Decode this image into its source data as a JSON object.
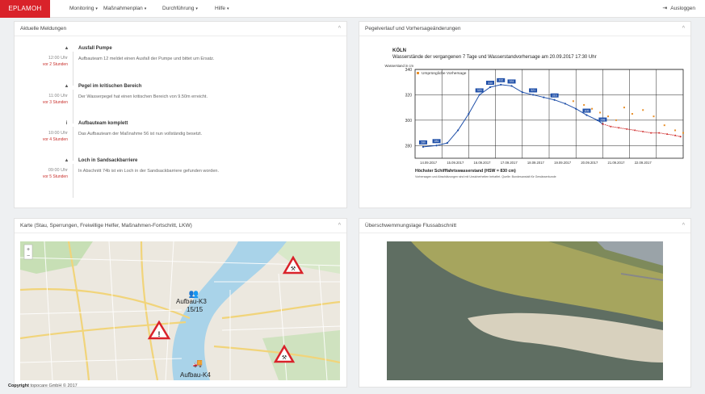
{
  "nav": {
    "brand": "EPLAMOH",
    "items": [
      {
        "label": "Monitoring"
      },
      {
        "label": "Maßnahmenplan"
      },
      {
        "label": "Durchführung"
      },
      {
        "label": "Hilfe"
      }
    ],
    "logout": "Ausloggen"
  },
  "panels": {
    "messages_title": "Aktuelle Meldungen",
    "chart_title": "Pegelverlauf und Vorhersageänderungen",
    "map_title": "Karte (Stau, Sperrungen, Freiwillige Helfer, Maßnahmen-Fortschritt, LKW)",
    "photo_title": "Überschwemmungslage Flussabschnitt"
  },
  "messages": [
    {
      "title": "Ausfall Pumpe",
      "text": "Aufbauteam 12 meldet einen Ausfall der Pumpe und bittet um Ersatz.",
      "time": "12:00 Uhr",
      "ago": "vor 2 Stunden",
      "icon": "warning-icon"
    },
    {
      "title": "Pegel im kritischen Bereich",
      "text": "Der Wasserpegel hat einen kritischen Bereich von 9.50m erreicht.",
      "time": "11:00 Uhr",
      "ago": "vor 3 Stunden",
      "icon": "warning-icon"
    },
    {
      "title": "Aufbauteam komplett",
      "text": "Das Aufbauteam der Maßnahme 56 ist nun vollständig besetzt.",
      "time": "10:00 Uhr",
      "ago": "vor 4 Stunden",
      "icon": "info-icon"
    },
    {
      "title": "Loch in Sandsackbarriere",
      "text": "In Abschnitt 74b ist ein Loch in der Sandsackbarriere gefunden worden.",
      "time": "09:00 Uhr",
      "ago": "vor 5 Stunden",
      "icon": "warning-icon"
    }
  ],
  "chart_data": {
    "type": "line",
    "title": "KÖLN",
    "subtitle": "Wasserstände der vergangenen 7 Tage und Wasserstandvorhersage am 20.09.2017 17:30 Uhr",
    "ylabel": "Wasserstand in cm",
    "legend": "Ursprüngliche Vorhersage",
    "ylim": [
      270,
      340
    ],
    "yticks": [
      280,
      300,
      320,
      340
    ],
    "xtick_labels": [
      "14.09.2017",
      "15.09.2017",
      "16.09.2017",
      "17.09.2017",
      "18.09.2017",
      "19.09.2017",
      "20.09.2017",
      "21.09.2017",
      "22.09.2017"
    ],
    "x_range": [
      0,
      10
    ],
    "series": [
      {
        "values_x": [
          0.3,
          0.8,
          1.2,
          1.6,
          2.0,
          2.4,
          2.8,
          3.2,
          3.6,
          4.0,
          4.4,
          4.8,
          5.2,
          5.6,
          6.0,
          6.4,
          6.8,
          7.0
        ],
        "values_y": [
          279,
          280,
          282,
          292,
          305,
          320,
          326,
          328,
          327,
          322,
          320,
          318,
          316,
          313,
          309,
          304,
          300,
          297
        ]
      },
      {
        "values_x": [
          7.0,
          7.3,
          7.6,
          7.9,
          8.2,
          8.5,
          8.8,
          9.1,
          9.4,
          9.7,
          9.9
        ],
        "values_y": [
          297,
          295,
          294,
          293,
          292,
          291,
          290,
          290,
          289,
          288,
          287
        ]
      },
      {
        "values_x": [
          5.9,
          6.3,
          6.6,
          6.9,
          7.2,
          7.5,
          7.8,
          8.1,
          8.5,
          8.9,
          9.3,
          9.7,
          10.0
        ],
        "values_y": [
          315,
          312,
          309,
          306,
          303,
          300,
          310,
          305,
          308,
          303,
          296,
          292,
          290
        ]
      }
    ],
    "data_labels": [
      {
        "x": 0.3,
        "y": 279,
        "text": "280"
      },
      {
        "x": 0.8,
        "y": 280,
        "text": "281"
      },
      {
        "x": 2.4,
        "y": 320,
        "text": "320"
      },
      {
        "x": 2.8,
        "y": 326,
        "text": "330"
      },
      {
        "x": 3.2,
        "y": 328,
        "text": "332"
      },
      {
        "x": 3.6,
        "y": 327,
        "text": "331"
      },
      {
        "x": 4.4,
        "y": 320,
        "text": "321"
      },
      {
        "x": 5.2,
        "y": 316,
        "text": "316"
      },
      {
        "x": 6.4,
        "y": 304,
        "text": "305"
      },
      {
        "x": 7.0,
        "y": 297,
        "text": "298"
      }
    ],
    "footnote": "Höchster Schifffahrtswasserstand (HSW = 830 cm)",
    "footnote2": "Vorhersagen und Abschätzungen sind mit Unsicherheiten behaftet. Quelle: Bundesanstalt für Gewässerkunde"
  },
  "map": {
    "labels": [
      {
        "text": "Aufbau-K3"
      },
      {
        "text": "15/15"
      },
      {
        "text": "Aufbau-K4"
      }
    ]
  },
  "footer": {
    "copyright": "Copyright",
    "company": "topocare GmbH © 2017"
  }
}
